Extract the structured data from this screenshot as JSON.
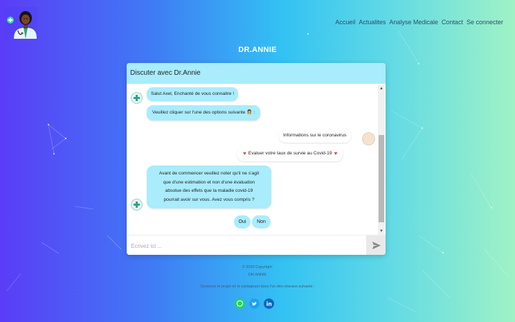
{
  "nav": {
    "items": [
      "Accueil",
      "Actualites",
      "Analyse Medicale",
      "Contact",
      "Se connecter"
    ]
  },
  "brand": "DR.ANNIE",
  "chat": {
    "header": "Discuter avec Dr.Annie",
    "messages": {
      "greeting": "Salut Axel, Enchanté de vous connaitre !",
      "choose": "Veuillez cliquer sur l'une des options suivante 👩‍⚕️ :",
      "option_info": "Informations sur le coronavirus",
      "option_eval": "Evaluer votre taux de survie au Covid-19",
      "disclaimer_1": "Avant de commencer veuillez noter qu'il ne s'agit",
      "disclaimer_2": "que d'une estimation et non d'une évaluation",
      "disclaimer_3": "absolue des effets que la maladie covid-19",
      "disclaimer_4": "pourrait avoir sur vous. Avez vous compris ?"
    },
    "answers": [
      "Oui",
      "Non"
    ],
    "input_placeholder": "Ecrivez ici ..."
  },
  "footer": {
    "copyright": "© 2020 Copyright:",
    "name": "DR.ANNIE",
    "share_text": "Soutenez le projet en le partageant dans l'un des réseaux suivants :"
  },
  "social": [
    "whatsapp-icon",
    "twitter-icon",
    "linkedin-icon"
  ],
  "colors": {
    "bot_bubble": "#a9ecfc",
    "header": "#a9ecfc",
    "whatsapp": "#25d366",
    "twitter": "#1da1f2",
    "linkedin": "#0a66c2"
  }
}
